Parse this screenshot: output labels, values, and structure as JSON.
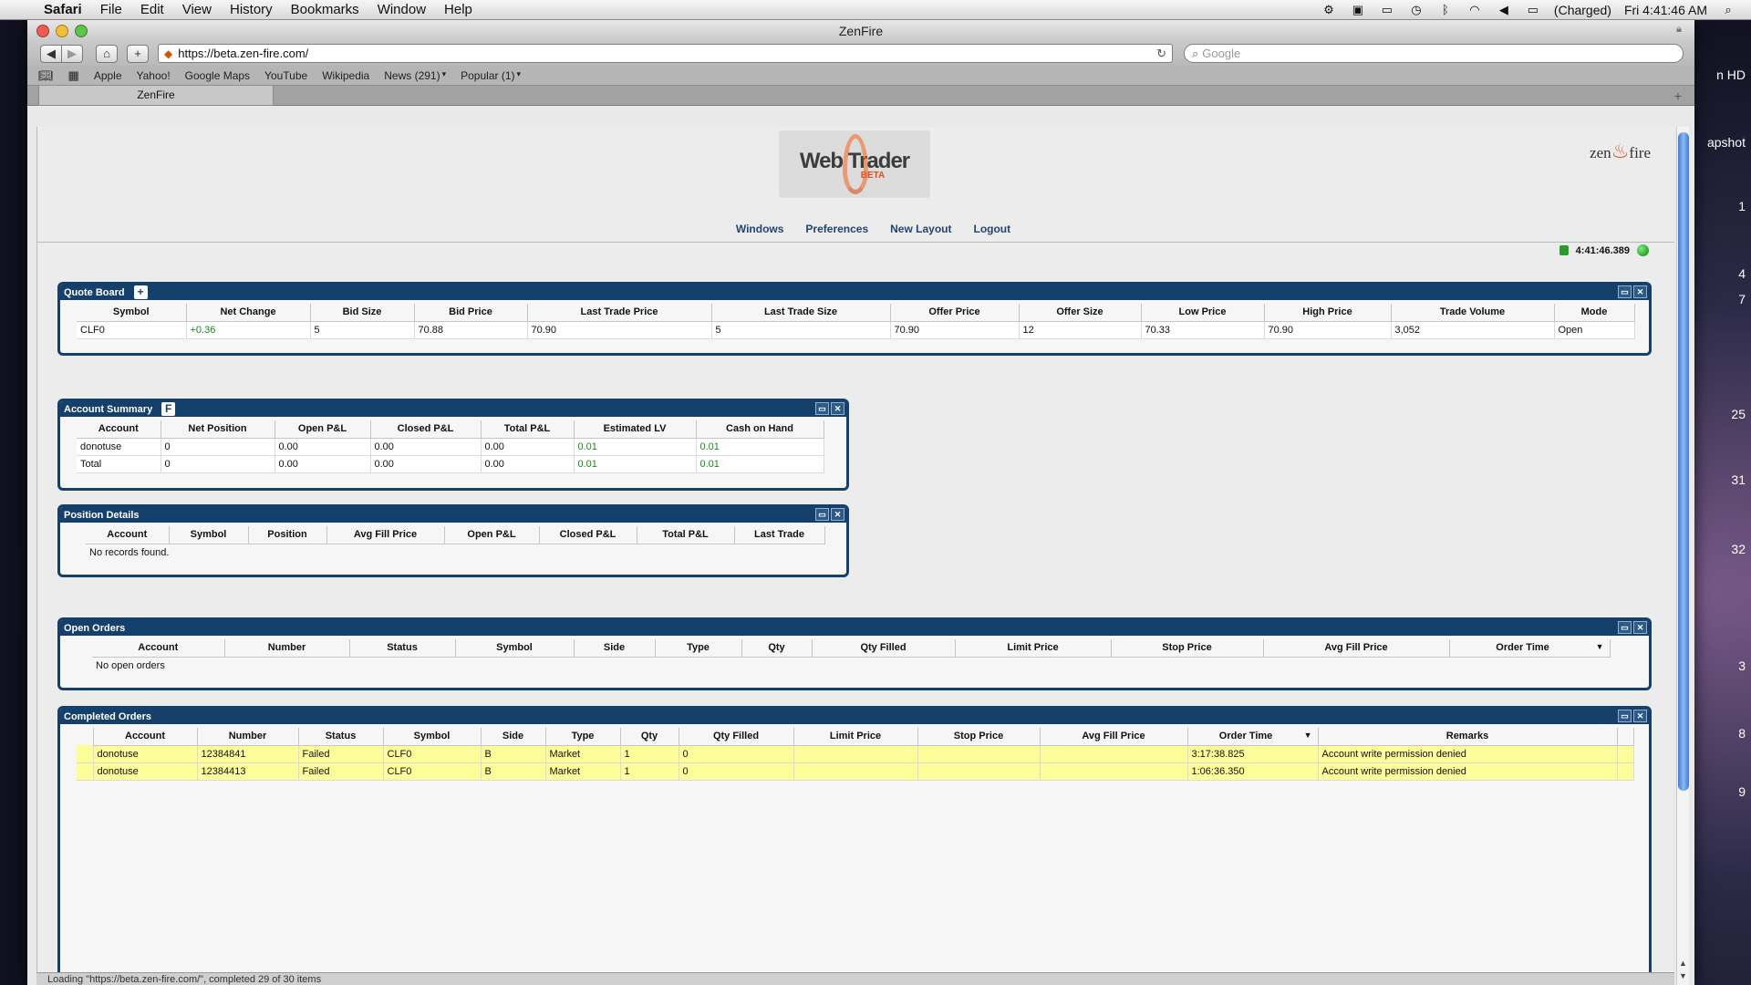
{
  "menubar": {
    "app": "Safari",
    "items": [
      "File",
      "Edit",
      "View",
      "History",
      "Bookmarks",
      "Window",
      "Help"
    ],
    "battery": "(Charged)",
    "clock": "Fri 4:41:46 AM"
  },
  "desktop": {
    "labels": [
      "n HD",
      "apshot",
      "1",
      "4",
      "7",
      "25",
      "31",
      "32",
      "3",
      "8",
      "9"
    ]
  },
  "window": {
    "title": "ZenFire"
  },
  "toolbar": {
    "url": "https://beta.zen-fire.com/",
    "search_placeholder": "Google"
  },
  "bookmarks": [
    "Apple",
    "Yahoo!",
    "Google Maps",
    "YouTube",
    "Wikipedia",
    "News (291)",
    "Popular (1)"
  ],
  "tab": {
    "label": "ZenFire"
  },
  "header": {
    "logo_text": "Web Trader",
    "logo_sub": "BETA",
    "brand": "zen",
    "brand_fire": "fire"
  },
  "nav": [
    "Windows",
    "Preferences",
    "New Layout",
    "Logout"
  ],
  "clock": "4:41:46.389",
  "quote_board": {
    "title": "Quote Board",
    "add": "+",
    "columns": [
      "Symbol",
      "Net Change",
      "Bid Size",
      "Bid Price",
      "Last Trade Price",
      "Last Trade Size",
      "Offer Price",
      "Offer Size",
      "Low Price",
      "High Price",
      "Trade Volume",
      "Mode"
    ],
    "rows": [
      [
        "CLF0",
        "+0.36",
        "5",
        "70.88",
        "70.90",
        "5",
        "70.90",
        "12",
        "70.33",
        "70.90",
        "3,052",
        "Open"
      ]
    ]
  },
  "account_summary": {
    "title": "Account Summary",
    "btn": "F",
    "columns": [
      "Account",
      "Net Position",
      "Open P&L",
      "Closed P&L",
      "Total P&L",
      "Estimated LV",
      "Cash on Hand"
    ],
    "rows": [
      [
        "donotuse",
        "0",
        "0.00",
        "0.00",
        "0.00",
        "0.01",
        "0.01"
      ],
      [
        "Total",
        "0",
        "0.00",
        "0.00",
        "0.00",
        "0.01",
        "0.01"
      ]
    ]
  },
  "position_details": {
    "title": "Position Details",
    "columns": [
      "Account",
      "Symbol",
      "Position",
      "Avg Fill Price",
      "Open P&L",
      "Closed P&L",
      "Total P&L",
      "Last Trade"
    ],
    "empty": "No records found."
  },
  "open_orders": {
    "title": "Open Orders",
    "columns": [
      "Account",
      "Number",
      "Status",
      "Symbol",
      "Side",
      "Type",
      "Qty",
      "Qty Filled",
      "Limit Price",
      "Stop Price",
      "Avg Fill Price",
      "Order Time"
    ],
    "empty": "No open orders"
  },
  "completed_orders": {
    "title": "Completed Orders",
    "columns": [
      "Account",
      "Number",
      "Status",
      "Symbol",
      "Side",
      "Type",
      "Qty",
      "Qty Filled",
      "Limit Price",
      "Stop Price",
      "Avg Fill Price",
      "Order Time",
      "Remarks"
    ],
    "rows": [
      [
        "donotuse",
        "12384841",
        "Failed",
        "CLF0",
        "B",
        "Market",
        "1",
        "0",
        "",
        "",
        "",
        "3:17:38.825",
        "Account write permission denied"
      ],
      [
        "donotuse",
        "12384413",
        "Failed",
        "CLF0",
        "B",
        "Market",
        "1",
        "0",
        "",
        "",
        "",
        "1:06:36.350",
        "Account write permission denied"
      ]
    ]
  },
  "status": "Loading \"https://beta.zen-fire.com/\", completed 29 of 30 items"
}
